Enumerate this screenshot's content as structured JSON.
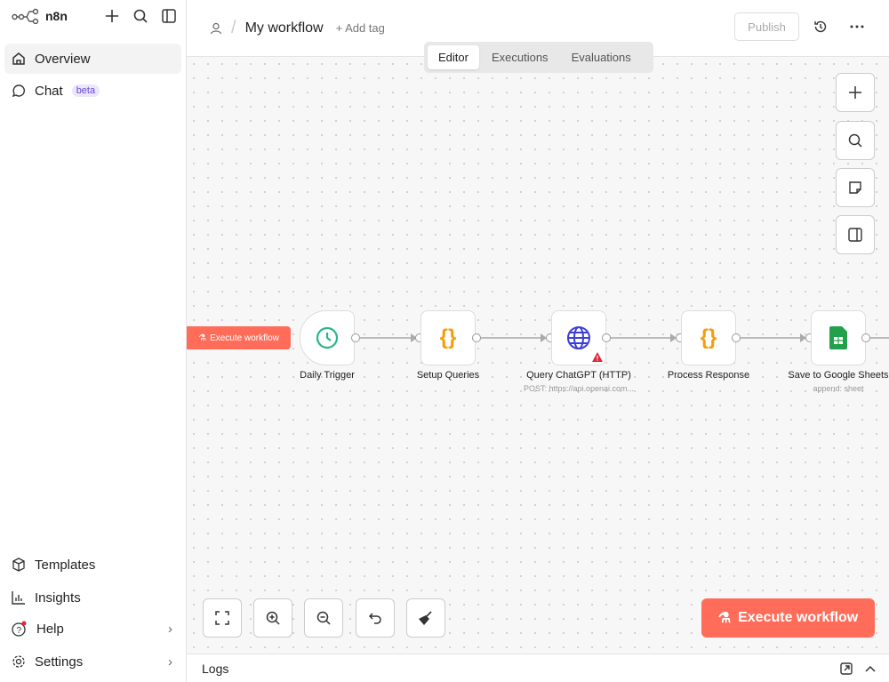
{
  "app": {
    "name": "n8n"
  },
  "sidebar": {
    "items": [
      {
        "label": "Overview",
        "icon": "home-icon"
      },
      {
        "label": "Chat",
        "icon": "chat-icon",
        "badge": "beta"
      }
    ],
    "bottom": [
      {
        "label": "Templates"
      },
      {
        "label": "Insights"
      },
      {
        "label": "Help"
      },
      {
        "label": "Settings"
      }
    ]
  },
  "header": {
    "workflow_name": "My workflow",
    "add_tag": "+ Add tag",
    "publish": "Publish"
  },
  "tabs": [
    {
      "label": "Editor",
      "active": true
    },
    {
      "label": "Executions"
    },
    {
      "label": "Evaluations"
    }
  ],
  "nodes": [
    {
      "label": "Daily Trigger",
      "subtitle": ""
    },
    {
      "label": "Setup Queries",
      "subtitle": ""
    },
    {
      "label": "Query ChatGPT (HTTP)",
      "subtitle": "POST: https://api.openai.com..."
    },
    {
      "label": "Process Response",
      "subtitle": ""
    },
    {
      "label": "Save to Google Sheets",
      "subtitle": "append: sheet"
    }
  ],
  "execute": {
    "small": "Execute workflow",
    "big": "Execute workflow"
  },
  "logs": {
    "label": "Logs"
  },
  "colors": {
    "accent": "#ff6d5a",
    "code": "#f59e0b",
    "http": "#3b3fd8",
    "trigger": "#2bb58a",
    "sheets": "#22a04b",
    "warning": "#e0263a"
  }
}
